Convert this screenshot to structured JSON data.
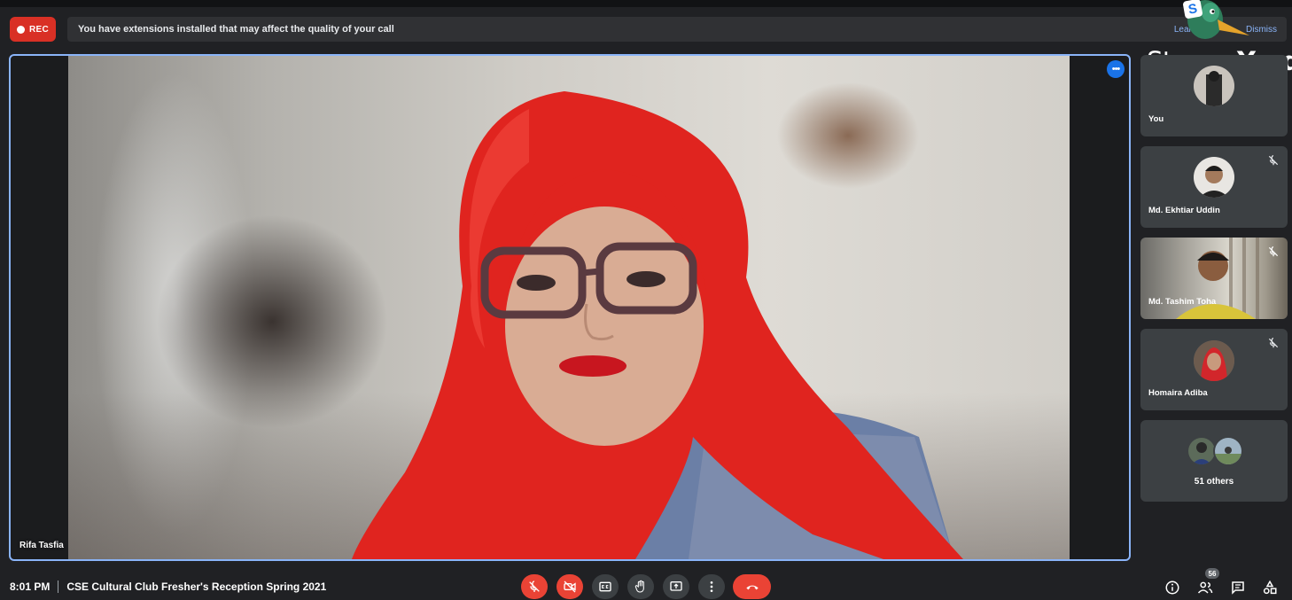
{
  "top": {
    "rec_label": "REC",
    "notice_text": "You have extensions installed that may affect the quality of your call",
    "notice_learn": "Learn more",
    "notice_dismiss": "Dismiss"
  },
  "logo": {
    "brand_prefix": "Stream",
    "brand_suffix": "Yard",
    "badge_letter": "S"
  },
  "stage": {
    "speaker_name": "Rifa Tasfia",
    "more_label": "•••"
  },
  "participants": [
    {
      "name": "You",
      "muted": false
    },
    {
      "name": "Md. Ekhtiar Uddin",
      "muted": true
    },
    {
      "name": "Md. Tashim Toha",
      "muted": true
    },
    {
      "name": "Homaira Adiba",
      "muted": true
    }
  ],
  "others": {
    "label": "51 others"
  },
  "bottom": {
    "time": "8:01 PM",
    "meeting_title": "CSE Cultural Club Fresher's Reception Spring 2021",
    "people_count": "56"
  },
  "colors": {
    "background": "#202124",
    "accent": "#8ab4f8",
    "danger": "#ea4335",
    "rec": "#d93025"
  },
  "icons": {
    "mic": "mic-off-icon",
    "camera": "camera-off-icon",
    "captions": "captions-icon",
    "hand": "raise-hand-icon",
    "present": "present-screen-icon",
    "more": "more-vert-icon",
    "end": "end-call-icon",
    "info": "info-icon",
    "people": "people-icon",
    "chat": "chat-icon",
    "activities": "activities-icon"
  }
}
